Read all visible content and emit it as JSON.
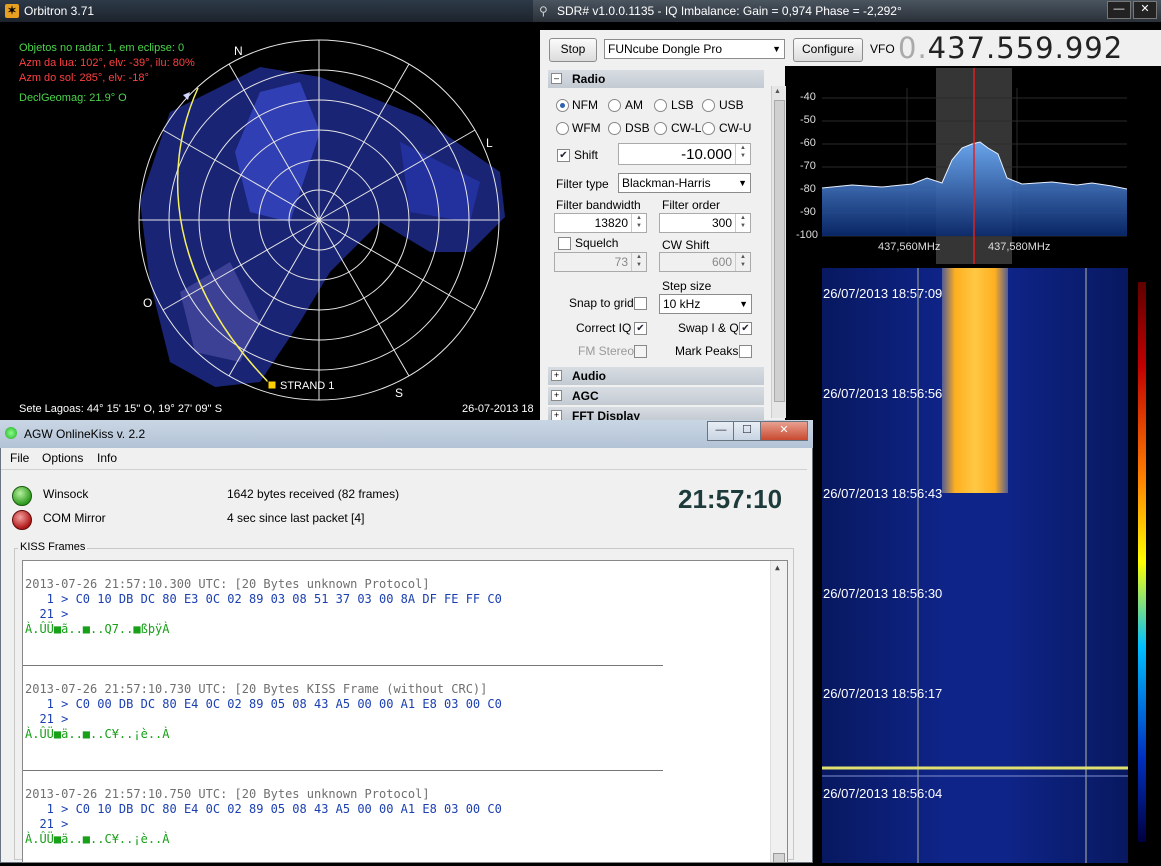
{
  "orbitron": {
    "title": "Orbitron 3.71",
    "info": [
      {
        "text": "Objetos no radar: 1, em eclipse: 0",
        "color": "#4cd44c"
      },
      {
        "text": "Azm da lua: 102°, elv: -39°, ilu: 80%",
        "color": "#ff4040"
      },
      {
        "text": "Azm do sol: 285°, elv: -18°",
        "color": "#ff4040"
      },
      {
        "text": "DeclGeomag: 21.9° O",
        "color": "#4cd44c"
      }
    ],
    "compass": {
      "n": "N",
      "l": "L",
      "s": "S",
      "o": "O"
    },
    "satellite": "STRAND 1",
    "location": "Sete Lagoas: 44° 15' 15'' O, 19° 27' 09'' S",
    "date": "26-07-2013 18"
  },
  "sdr": {
    "title": "SDR# v1.0.0.1135 - IQ Imbalance: Gain = 0,974 Phase = -2,292°",
    "stop_label": "Stop",
    "device": "FUNcube Dongle Pro",
    "configure_label": "Configure",
    "vfo_label": "VFO",
    "vfo_prefix": "0.",
    "vfo_value": "437.559.992",
    "radio_section": "Radio",
    "modes_row1": [
      "NFM",
      "AM",
      "LSB",
      "USB"
    ],
    "modes_row2": [
      "WFM",
      "DSB",
      "CW-L",
      "CW-U"
    ],
    "selected_mode": "NFM",
    "shift_label": "Shift",
    "shift_value": "-10.000",
    "filter_type_label": "Filter type",
    "filter_type_value": "Blackman-Harris",
    "filter_bw_label": "Filter bandwidth",
    "filter_bw_value": "13820",
    "filter_order_label": "Filter order",
    "filter_order_value": "300",
    "squelch_label": "Squelch",
    "squelch_value": "73",
    "cw_shift_label": "CW Shift",
    "cw_shift_value": "600",
    "step_size_label": "Step size",
    "step_size_value": "10 kHz",
    "snap_label": "Snap to grid",
    "correct_iq_label": "Correct IQ",
    "swap_iq_label": "Swap I & Q",
    "fm_stereo_label": "FM Stereo",
    "mark_peaks_label": "Mark Peaks",
    "audio_section": "Audio",
    "agc_section": "AGC",
    "fft_section": "FFT Display",
    "spectrum_levels": [
      "-40",
      "-50",
      "-60",
      "-70",
      "-80",
      "-90",
      "-100"
    ],
    "freq_labels": [
      "437,560MHz",
      "437,580MHz"
    ],
    "waterfall_times": [
      "26/07/2013 18:57:09",
      "26/07/2013 18:56:56",
      "26/07/2013 18:56:43",
      "26/07/2013 18:56:30",
      "26/07/2013 18:56:17",
      "26/07/2013 18:56:04"
    ],
    "waterfall_bg": "#0a1a6a",
    "signal_color": "#ffb020"
  },
  "agw": {
    "title": "AGW OnlineKiss v. 2.2",
    "menu": [
      "File",
      "Options",
      "Info"
    ],
    "winsock_label": "Winsock",
    "winsock_status": "1642 bytes received (82 frames)",
    "com_label": "COM Mirror",
    "com_status": "4 sec since last packet [4]",
    "clock": "21:57:10",
    "kiss_title": "KISS Frames",
    "frames": [
      {
        "header": "2013-07-26 21:57:10.300 UTC: [20 Bytes unknown Protocol]",
        "hex": "   1 > C0 10 DB DC 80 E3 0C 02 89 03 08 51 37 03 00 8A DF FE FF C0",
        "cont": "  21 >",
        "ascii": "À.ÛÜ■ã..■..Q7..■ßþÿÀ"
      },
      {
        "header": "2013-07-26 21:57:10.730 UTC: [20 Bytes KISS Frame (without CRC)]",
        "hex": "   1 > C0 00 DB DC 80 E4 0C 02 89 05 08 43 A5 00 00 A1 E8 03 00 C0",
        "cont": "  21 >",
        "ascii": "À.ÛÜ■ä..■..C¥..¡è..À"
      },
      {
        "header": "2013-07-26 21:57:10.750 UTC: [20 Bytes unknown Protocol]",
        "hex": "   1 > C0 10 DB DC 80 E4 0C 02 89 05 08 43 A5 00 00 A1 E8 03 00 C0",
        "cont": "  21 >",
        "ascii": "À.ÛÜ■ä..■..C¥..¡è..À"
      }
    ]
  }
}
